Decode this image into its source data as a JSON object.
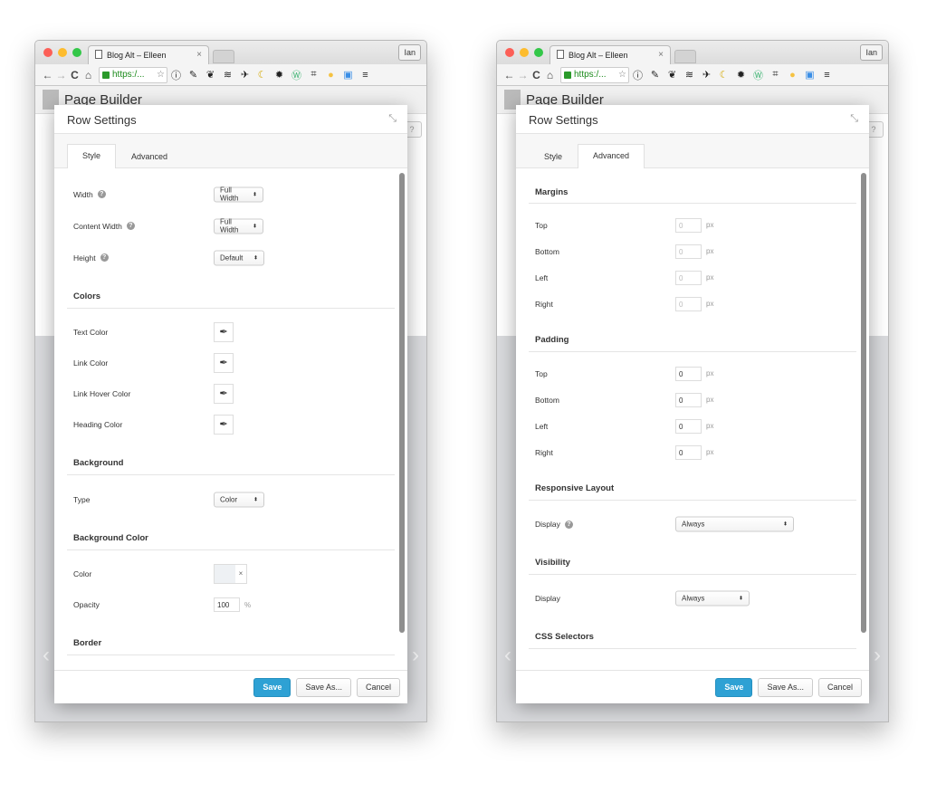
{
  "colors": {
    "accent": "#2ea1d4",
    "traffic": [
      "#fc5f57",
      "#fdbc2e",
      "#33c748"
    ]
  },
  "windows": [
    {
      "tab_title": "Blog Alt – Elleen",
      "user": "Ian",
      "url": "https:/...",
      "page_title": "Page Builder",
      "extension_icons": [
        "info-icon",
        "eyedropper-icon",
        "evernote-icon",
        "buffer-icon",
        "pin-icon",
        "moon-icon",
        "gear-icon",
        "wordpress-icon",
        "screenshot-icon",
        "coin-icon",
        "chart-icon"
      ],
      "modal": {
        "title": "Row Settings",
        "tabs": [
          "Style",
          "Advanced"
        ],
        "active_tab": 0,
        "sections": [
          {
            "heading": "",
            "row_height": 35,
            "fields": [
              {
                "label": "Width",
                "help": true,
                "type": "select",
                "value": "Full Width"
              },
              {
                "label": "Content Width",
                "help": true,
                "type": "select",
                "value": "Full Width"
              },
              {
                "label": "Height",
                "help": true,
                "type": "select",
                "value": "Default",
                "wide": true
              }
            ]
          },
          {
            "heading": "Colors",
            "row_height": 34,
            "fields": [
              {
                "label": "Text Color",
                "type": "picker"
              },
              {
                "label": "Link Color",
                "type": "picker"
              },
              {
                "label": "Link Hover Color",
                "type": "picker"
              },
              {
                "label": "Heading Color",
                "type": "picker"
              }
            ]
          },
          {
            "heading": "Background",
            "row_height": 35,
            "fields": [
              {
                "label": "Type",
                "type": "select",
                "value": "Color",
                "wide": true
              }
            ]
          },
          {
            "heading": "Background Color",
            "row_height": 34,
            "fields": [
              {
                "label": "Color",
                "type": "color-clear"
              },
              {
                "label": "Opacity",
                "type": "number",
                "value": "100",
                "unit": "%"
              }
            ]
          },
          {
            "heading": "Border",
            "row_height": 34,
            "fields": []
          }
        ],
        "buttons": {
          "save": "Save",
          "save_as": "Save As...",
          "cancel": "Cancel"
        }
      }
    },
    {
      "tab_title": "Blog Alt – Elleen",
      "user": "Ian",
      "url": "https:/...",
      "page_title": "Page Builder",
      "extension_icons": [
        "info-icon",
        "eyedropper-icon",
        "evernote-icon",
        "buffer-icon",
        "pin-icon",
        "moon-icon",
        "gear-icon",
        "wordpress-icon",
        "screenshot-icon",
        "coin-icon",
        "chart-icon"
      ],
      "modal": {
        "title": "Row Settings",
        "tabs": [
          "Style",
          "Advanced"
        ],
        "active_tab": 1,
        "sections": [
          {
            "heading": "Margins",
            "row_height": 29,
            "first": true,
            "fields": [
              {
                "label": "Top",
                "type": "number",
                "placeholder": "0",
                "unit": "px"
              },
              {
                "label": "Bottom",
                "type": "number",
                "placeholder": "0",
                "unit": "px"
              },
              {
                "label": "Left",
                "type": "number",
                "placeholder": "0",
                "unit": "px"
              },
              {
                "label": "Right",
                "type": "number",
                "placeholder": "0",
                "unit": "px"
              }
            ]
          },
          {
            "heading": "Padding",
            "row_height": 29,
            "fields": [
              {
                "label": "Top",
                "type": "number",
                "value": "0",
                "unit": "px"
              },
              {
                "label": "Bottom",
                "type": "number",
                "value": "0",
                "unit": "px"
              },
              {
                "label": "Left",
                "type": "number",
                "value": "0",
                "unit": "px"
              },
              {
                "label": "Right",
                "type": "number",
                "value": "0",
                "unit": "px"
              }
            ]
          },
          {
            "heading": "Responsive Layout",
            "row_height": 34,
            "fields": [
              {
                "label": "Display",
                "help": true,
                "type": "select",
                "value": "Always",
                "xwide": true
              }
            ]
          },
          {
            "heading": "Visibility",
            "row_height": 34,
            "fields": [
              {
                "label": "Display",
                "type": "select",
                "value": "Always",
                "mwide": true
              }
            ]
          },
          {
            "heading": "CSS Selectors",
            "row_height": 34,
            "fields": []
          }
        ],
        "buttons": {
          "save": "Save",
          "save_as": "Save As...",
          "cancel": "Cancel"
        }
      }
    }
  ]
}
